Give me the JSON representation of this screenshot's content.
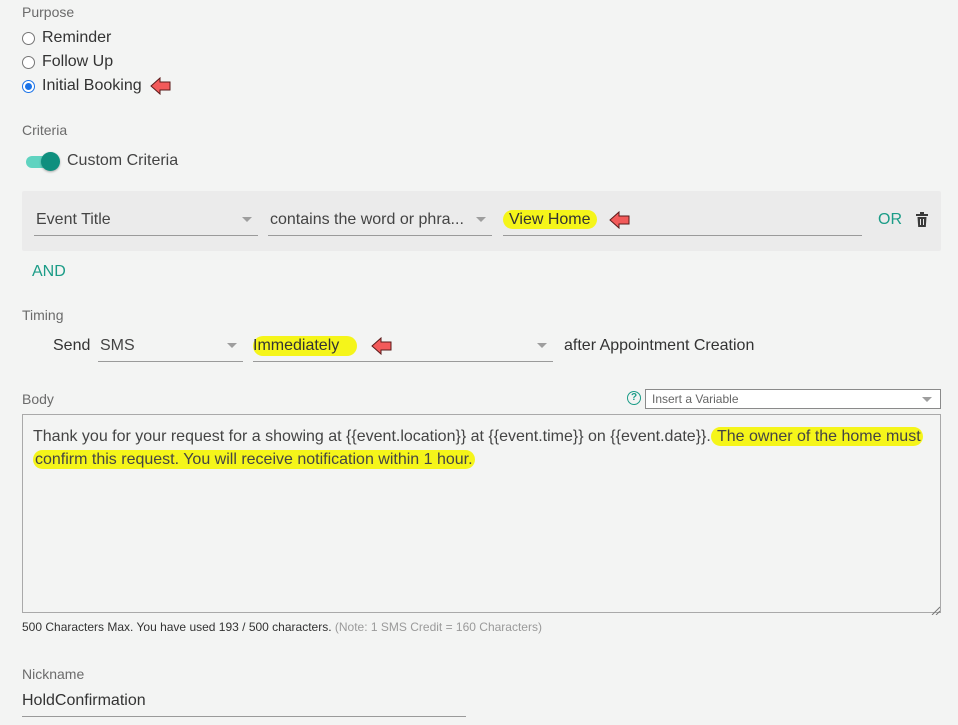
{
  "purpose": {
    "label": "Purpose",
    "options": [
      {
        "label": "Reminder",
        "checked": false
      },
      {
        "label": "Follow Up",
        "checked": false
      },
      {
        "label": "Initial Booking",
        "checked": true
      }
    ]
  },
  "criteria": {
    "label": "Criteria",
    "toggle_label": "Custom Criteria",
    "toggle_on": true,
    "rule": {
      "field": "Event Title",
      "operator": "contains the word or phra...",
      "value": "View Home",
      "or_label": "OR"
    },
    "and_label": "AND"
  },
  "timing": {
    "label": "Timing",
    "send_label": "Send",
    "channel": "SMS",
    "when": "Immediately",
    "suffix": "after Appointment Creation"
  },
  "body": {
    "label": "Body",
    "help_icon": "?",
    "insert_variable_placeholder": "Insert a Variable",
    "text_plain": "Thank you for your request for a showing at {{event.location}} at {{event.time}} on {{event.date}}.",
    "text_highlighted_line1": " The owner of the home must",
    "text_highlighted_line2": "confirm this request. You will receive notification within 1 hour.",
    "counter_text": "500 Characters Max. You have used 193 / 500 characters.",
    "counter_note": "(Note: 1 SMS Credit = 160 Characters)"
  },
  "nickname": {
    "label": "Nickname",
    "value": "HoldConfirmation"
  },
  "colors": {
    "accent": "#1b9c87",
    "highlight": "#f5f51a",
    "arrow": "#f25a5a",
    "background": "#f3f4f3"
  }
}
